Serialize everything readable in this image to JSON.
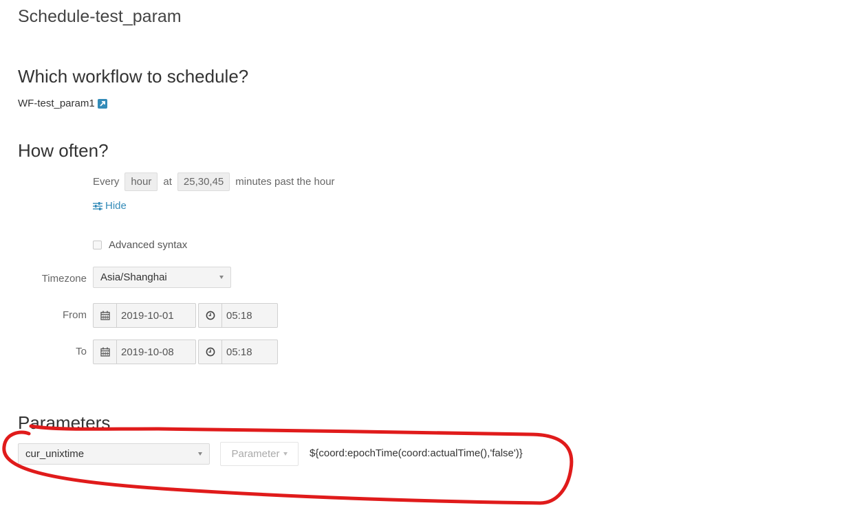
{
  "page": {
    "title": "Schedule-test_param"
  },
  "workflow": {
    "heading": "Which workflow to schedule?",
    "name": "WF-test_param1",
    "link_icon": "external-link-icon"
  },
  "frequency": {
    "heading": "How often?",
    "every_label": "Every",
    "unit_value": "hour",
    "at_label": "at",
    "minutes_value": "25,30,45",
    "suffix": "minutes past the hour",
    "hide_label": "Hide",
    "hide_icon": "sliders-icon",
    "advanced_label": "Advanced syntax",
    "advanced_checked": false
  },
  "timezone": {
    "label": "Timezone",
    "value": "Asia/Shanghai"
  },
  "range": {
    "from_label": "From",
    "from_date": "2019-10-01",
    "from_time": "05:18",
    "to_label": "To",
    "to_date": "2019-10-08",
    "to_time": "05:18",
    "date_icon": "calendar-icon",
    "time_icon": "clock-icon"
  },
  "parameters": {
    "heading": "Parameters",
    "name_value": "cur_unixtime",
    "type_button_label": "Parameter",
    "value": "${coord:epochTime(coord:actualTime(),'false')}"
  },
  "colors": {
    "accent": "#338bb8",
    "annotation": "#e01b1b"
  }
}
